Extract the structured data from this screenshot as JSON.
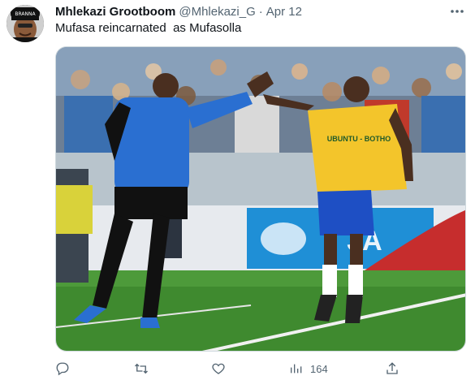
{
  "tweet": {
    "author_name": "Mhlekazi Grootboom",
    "handle": "@Mhlekazi_G",
    "separator": "·",
    "date": "Apr 12",
    "text": "Mufasa reincarnated  as Mufasolla",
    "avatar_cap_text": "BRANNA",
    "jersey_text": "UBUNTU - BOTHO",
    "board_text": "JA",
    "views_count": "164"
  },
  "icons": {
    "more": "more-horizontal-icon",
    "reply": "reply-icon",
    "retweet": "retweet-icon",
    "like": "like-icon",
    "views": "views-icon",
    "share": "share-icon"
  },
  "colors": {
    "text_primary": "#0f1419",
    "text_secondary": "#536471",
    "border": "#cfd9de",
    "jersey_yellow": "#f3c52b",
    "coach_blue": "#2a6fd1",
    "pitch_green": "#3f8a2f"
  }
}
